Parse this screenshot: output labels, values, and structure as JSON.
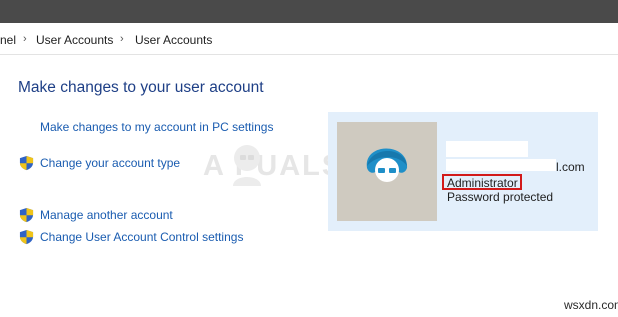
{
  "breadcrumb": {
    "items": [
      "nel",
      "User Accounts",
      "User Accounts"
    ],
    "separator": "›"
  },
  "main": {
    "title": "Make changes to your user account",
    "links": [
      {
        "label": "Make changes to my account in PC settings",
        "icon": null
      },
      {
        "label": "Change your account type",
        "icon": "uac-shield-icon"
      },
      {
        "label": "Manage another account",
        "icon": "uac-shield-icon"
      },
      {
        "label": "Change User Account Control settings",
        "icon": "uac-shield-icon"
      }
    ]
  },
  "account": {
    "email_suffix": "l.com",
    "account_type": "Administrator",
    "password_status": "Password protected",
    "avatar_icon": "default-user-avatar"
  },
  "watermark": {
    "text": "A  PUALS"
  },
  "site_mark": "wsxdn.com",
  "colors": {
    "title": "#1e3f86",
    "link": "#1a5cb0",
    "panel_bg": "#e3effb",
    "highlight": "#d21a1a",
    "titlebar": "#4a4a4a"
  }
}
